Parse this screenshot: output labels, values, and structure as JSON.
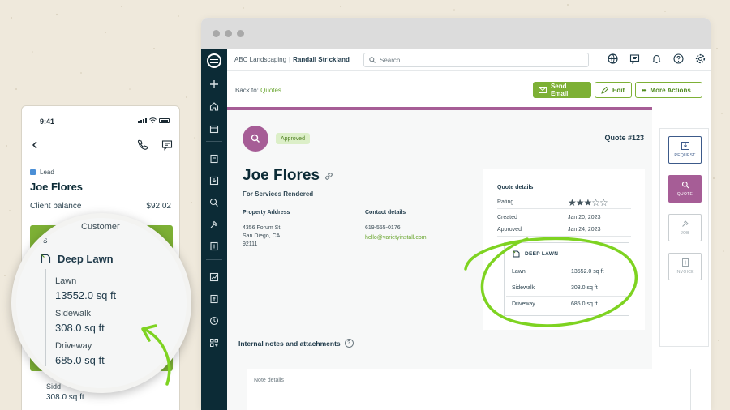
{
  "desktop": {
    "company_name": "ABC Landscaping",
    "user_name": "Randall Strickland",
    "search_placeholder": "Search",
    "back_to_label": "Back to:",
    "back_to_link": "Quotes",
    "buttons": {
      "send_email": "Send Email",
      "edit": "Edit",
      "more_actions": "More Actions"
    },
    "quote": {
      "status": "Approved",
      "number": "Quote #123",
      "client_name": "Joe Flores",
      "subtitle": "For Services Rendered",
      "property_address_label": "Property Address",
      "address_line1": "4356 Forum St,",
      "address_line2": "San Diego, CA",
      "address_line3": "92111",
      "contact_label": "Contact details",
      "phone": "619-555-0176",
      "email": "hello@varietyinstall.com"
    },
    "quote_details": {
      "title": "Quote details",
      "rating_label": "Rating",
      "rating": 3,
      "rating_max": 5,
      "created_label": "Created",
      "created_value": "Jan 20, 2023",
      "approved_label": "Approved",
      "approved_value": "Jan 24, 2023",
      "lawn_section_title": "DEEP LAWN",
      "lawn_rows": [
        {
          "label": "Lawn",
          "value": "13552.0 sq ft"
        },
        {
          "label": "Sidewalk",
          "value": "308.0 sq ft"
        },
        {
          "label": "Driveway",
          "value": "685.0 sq ft"
        }
      ]
    },
    "notes": {
      "title": "Internal notes and attachments",
      "placeholder": "Note details"
    },
    "workflow": [
      {
        "label": "REQUEST"
      },
      {
        "label": "QUOTE"
      },
      {
        "label": "JOB"
      },
      {
        "label": "INVOICE"
      }
    ],
    "colors": {
      "accent_green": "#7db035",
      "quote_purple": "#a65d96",
      "sidebar_navy": "#0c2b36",
      "highlight_green": "#7ed321"
    }
  },
  "mobile": {
    "time": "9:41",
    "tag": "Lead",
    "client_name": "Joe Flores",
    "balance_label": "Client balance",
    "balance_value": "$92.02",
    "bottom_label": "Sidewalk",
    "bottom_label_visible": "Sidd",
    "bottom_value": "308.0 sq ft",
    "magnifier": {
      "customer_fragment": "Customer",
      "s_fragment": "s",
      "section_title": "Deep Lawn",
      "rows": [
        {
          "label": "Lawn",
          "value": "13552.0 sq ft"
        },
        {
          "label": "Sidewalk",
          "value": "308.0 sq ft"
        },
        {
          "label": "Driveway",
          "value": "685.0 sq ft"
        }
      ]
    }
  }
}
